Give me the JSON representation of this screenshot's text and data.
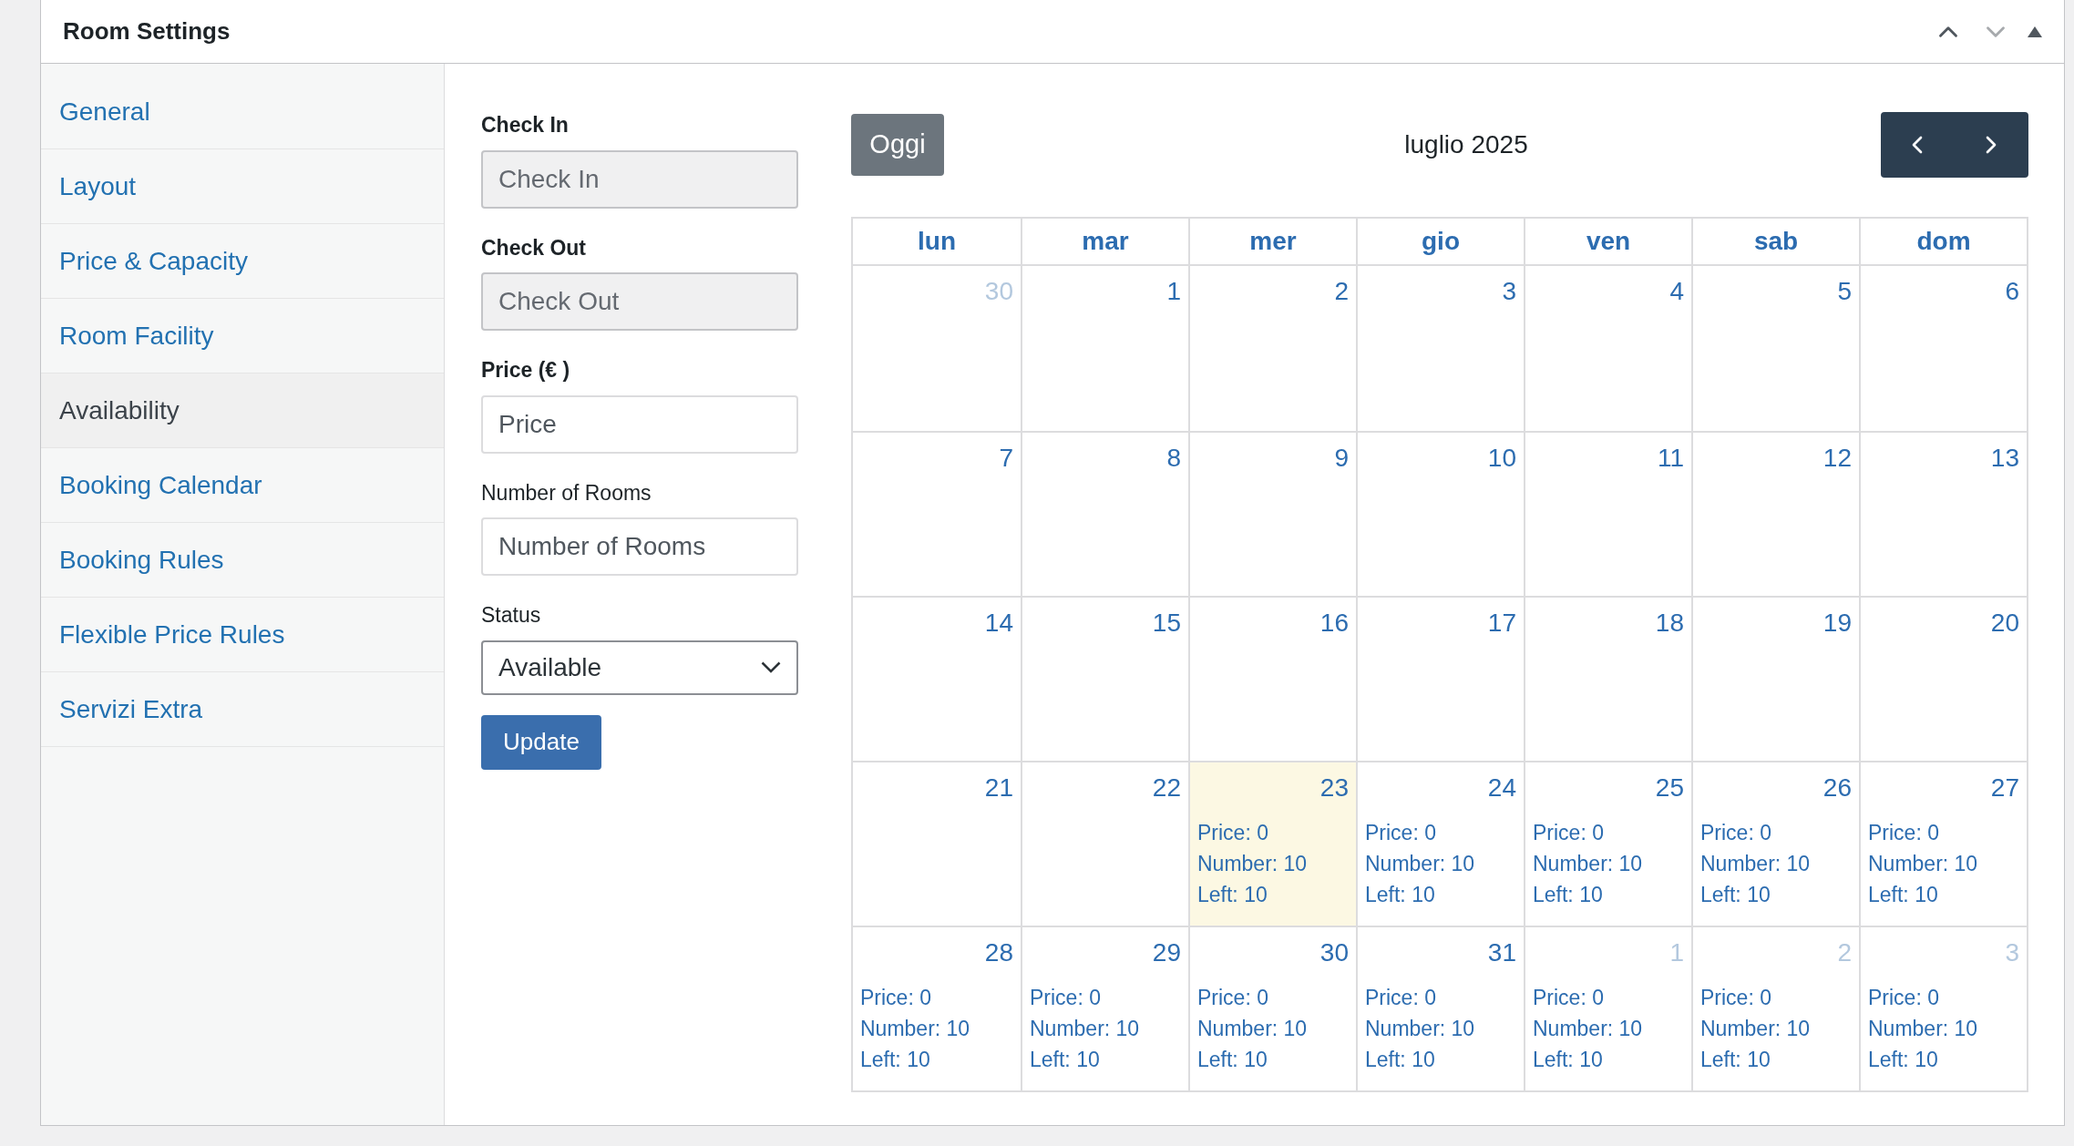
{
  "panel": {
    "title": "Room Settings"
  },
  "sidebar": {
    "items": [
      {
        "label": "General",
        "selected": false
      },
      {
        "label": "Layout",
        "selected": false
      },
      {
        "label": "Price & Capacity",
        "selected": false
      },
      {
        "label": "Room Facility",
        "selected": false
      },
      {
        "label": "Availability",
        "selected": true
      },
      {
        "label": "Booking Calendar",
        "selected": false
      },
      {
        "label": "Booking Rules",
        "selected": false
      },
      {
        "label": "Flexible Price Rules",
        "selected": false
      },
      {
        "label": "Servizi Extra",
        "selected": false
      }
    ]
  },
  "form": {
    "fields": [
      {
        "kind": "input",
        "label": "Check In",
        "placeholder": "Check In",
        "disabled": true,
        "bold": true
      },
      {
        "kind": "input",
        "label": "Check Out",
        "placeholder": "Check Out",
        "disabled": true,
        "bold": true
      },
      {
        "kind": "input",
        "label": "Price (€ )",
        "placeholder": "Price",
        "disabled": false,
        "bold": true
      },
      {
        "kind": "input",
        "label": "Number of Rooms",
        "placeholder": "Number of Rooms",
        "disabled": false,
        "bold": false
      },
      {
        "kind": "select",
        "label": "Status",
        "value": "Available",
        "bold": false
      }
    ],
    "submit": "Update"
  },
  "calendar": {
    "today_button": "Oggi",
    "month": "luglio 2025",
    "weekdays": [
      "lun",
      "mar",
      "mer",
      "gio",
      "ven",
      "sab",
      "dom"
    ],
    "weeks": [
      [
        {
          "day": "30",
          "other_month": true,
          "today": false
        },
        {
          "day": "1",
          "other_month": false,
          "today": false
        },
        {
          "day": "2",
          "other_month": false,
          "today": false
        },
        {
          "day": "3",
          "other_month": false,
          "today": false
        },
        {
          "day": "4",
          "other_month": false,
          "today": false
        },
        {
          "day": "5",
          "other_month": false,
          "today": false
        },
        {
          "day": "6",
          "other_month": false,
          "today": false
        }
      ],
      [
        {
          "day": "7",
          "other_month": false,
          "today": false
        },
        {
          "day": "8",
          "other_month": false,
          "today": false
        },
        {
          "day": "9",
          "other_month": false,
          "today": false
        },
        {
          "day": "10",
          "other_month": false,
          "today": false
        },
        {
          "day": "11",
          "other_month": false,
          "today": false
        },
        {
          "day": "12",
          "other_month": false,
          "today": false
        },
        {
          "day": "13",
          "other_month": false,
          "today": false
        }
      ],
      [
        {
          "day": "14",
          "other_month": false,
          "today": false
        },
        {
          "day": "15",
          "other_month": false,
          "today": false
        },
        {
          "day": "16",
          "other_month": false,
          "today": false
        },
        {
          "day": "17",
          "other_month": false,
          "today": false
        },
        {
          "day": "18",
          "other_month": false,
          "today": false
        },
        {
          "day": "19",
          "other_month": false,
          "today": false
        },
        {
          "day": "20",
          "other_month": false,
          "today": false
        }
      ],
      [
        {
          "day": "21",
          "other_month": false,
          "today": false
        },
        {
          "day": "22",
          "other_month": false,
          "today": false
        },
        {
          "day": "23",
          "other_month": false,
          "today": true,
          "info": [
            "Price: 0",
            "Number: 10",
            "Left: 10"
          ]
        },
        {
          "day": "24",
          "other_month": false,
          "today": false,
          "info": [
            "Price: 0",
            "Number: 10",
            "Left: 10"
          ]
        },
        {
          "day": "25",
          "other_month": false,
          "today": false,
          "info": [
            "Price: 0",
            "Number: 10",
            "Left: 10"
          ]
        },
        {
          "day": "26",
          "other_month": false,
          "today": false,
          "info": [
            "Price: 0",
            "Number: 10",
            "Left: 10"
          ]
        },
        {
          "day": "27",
          "other_month": false,
          "today": false,
          "info": [
            "Price: 0",
            "Number: 10",
            "Left: 10"
          ]
        }
      ],
      [
        {
          "day": "28",
          "other_month": false,
          "today": false,
          "info": [
            "Price: 0",
            "Number: 10",
            "Left: 10"
          ]
        },
        {
          "day": "29",
          "other_month": false,
          "today": false,
          "info": [
            "Price: 0",
            "Number: 10",
            "Left: 10"
          ]
        },
        {
          "day": "30",
          "other_month": false,
          "today": false,
          "info": [
            "Price: 0",
            "Number: 10",
            "Left: 10"
          ]
        },
        {
          "day": "31",
          "other_month": false,
          "today": false,
          "info": [
            "Price: 0",
            "Number: 10",
            "Left: 10"
          ]
        },
        {
          "day": "1",
          "other_month": true,
          "today": false,
          "info": [
            "Price: 0",
            "Number: 10",
            "Left: 10"
          ]
        },
        {
          "day": "2",
          "other_month": true,
          "today": false,
          "info": [
            "Price: 0",
            "Number: 10",
            "Left: 10"
          ]
        },
        {
          "day": "3",
          "other_month": true,
          "today": false,
          "info": [
            "Price: 0",
            "Number: 10",
            "Left: 10"
          ]
        }
      ]
    ]
  }
}
